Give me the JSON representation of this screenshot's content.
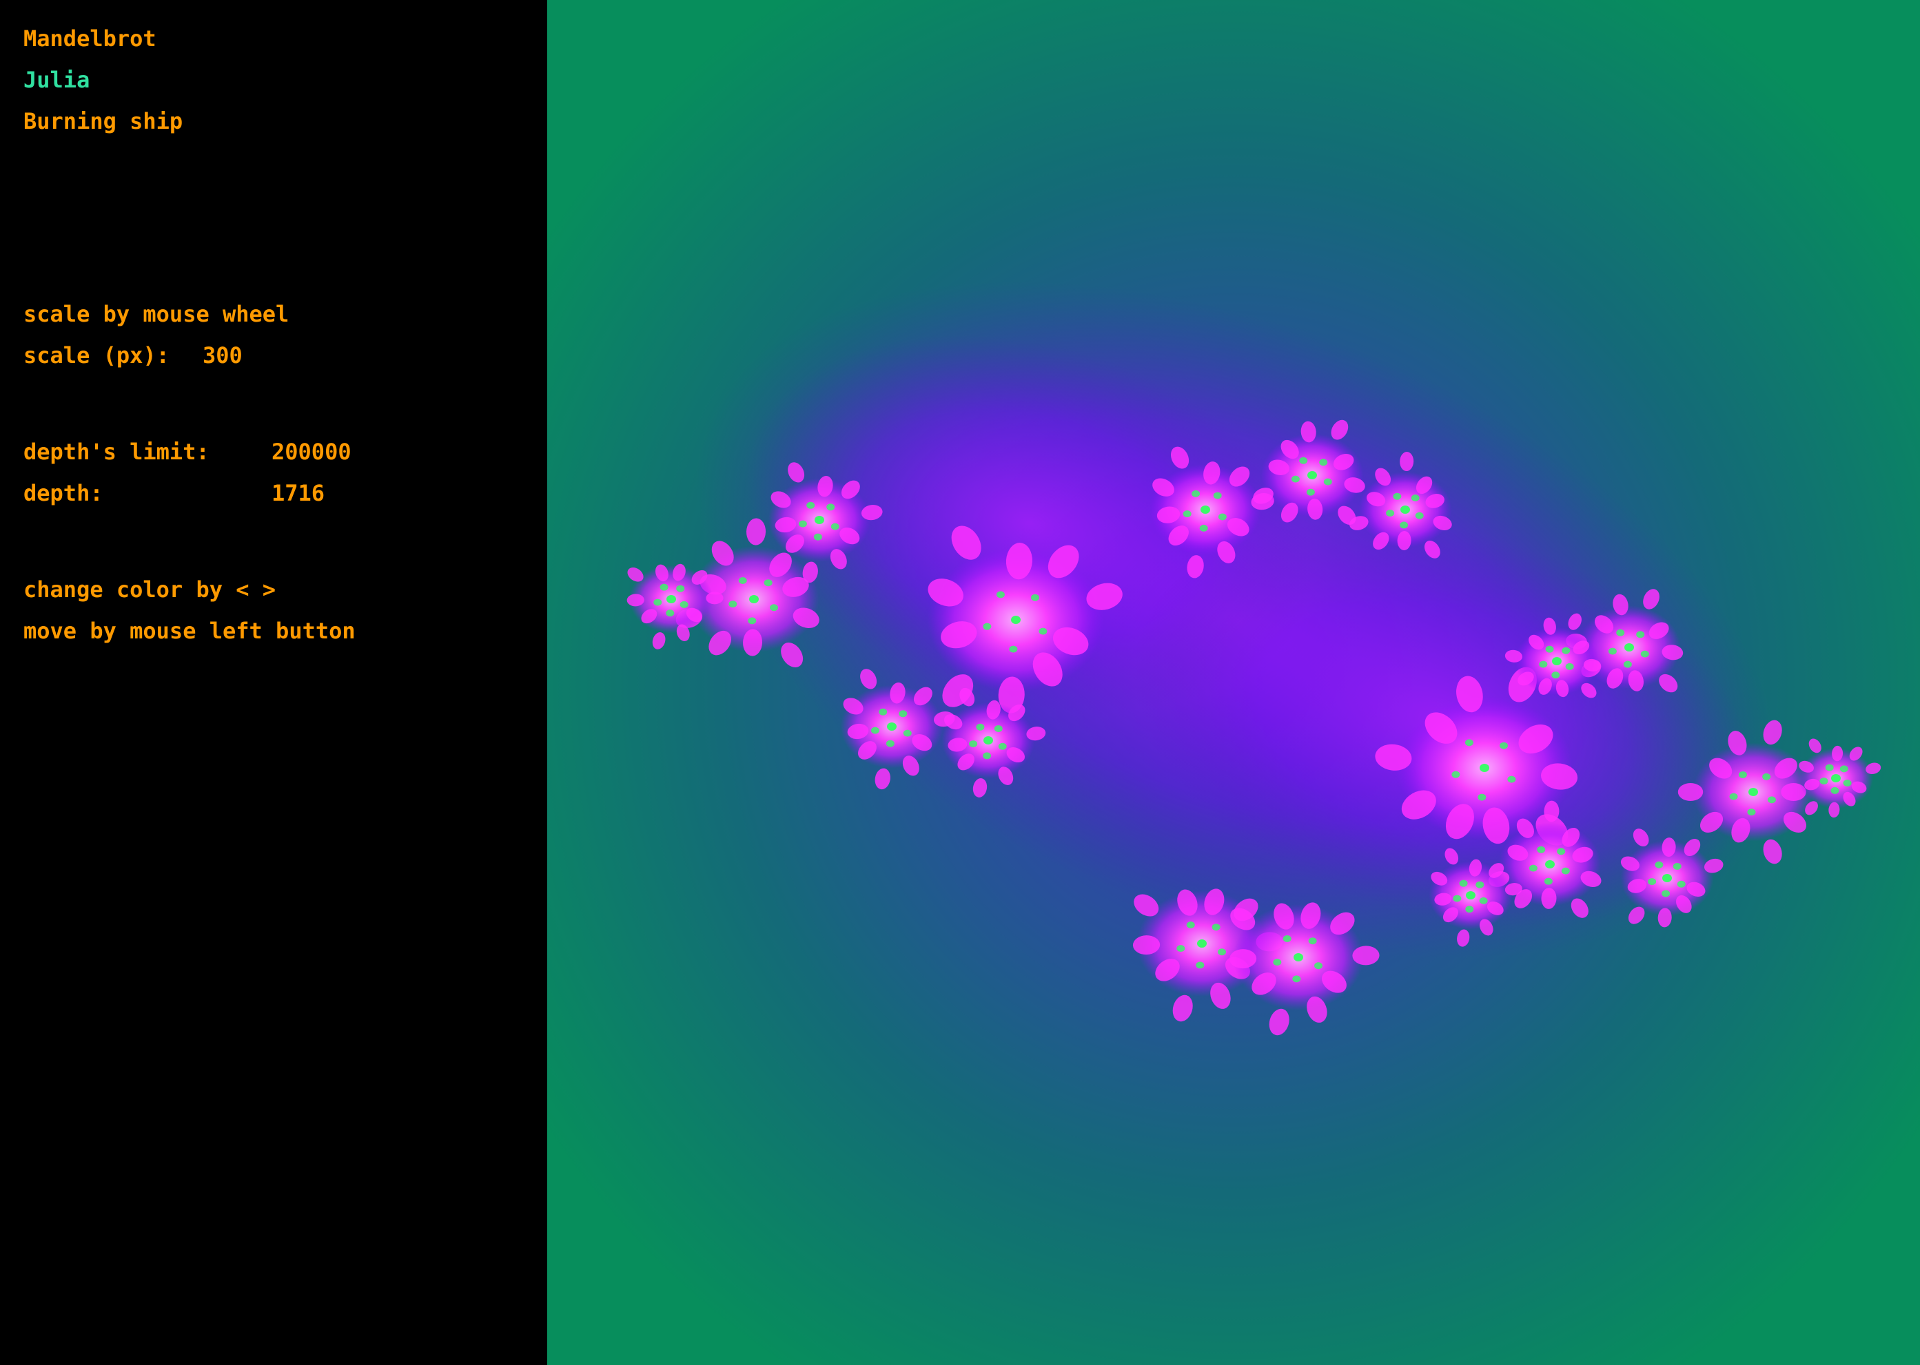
{
  "menu": {
    "items": [
      {
        "label": "Mandelbrot",
        "active": false
      },
      {
        "label": "Julia",
        "active": true
      },
      {
        "label": "Burning ship",
        "active": false
      }
    ]
  },
  "info": {
    "scale_hint": "scale by mouse wheel",
    "scale_label": "scale (px):",
    "scale_value": "300",
    "depth_limit_label": "depth's limit:",
    "depth_limit_value": "200000",
    "depth_label": "depth:",
    "depth_value": "1716",
    "color_hint": "change color by < >",
    "move_hint": "move by mouse left button"
  },
  "colors": {
    "text": "#ff9a00",
    "active": "#30e0a0",
    "panel_bg": "#000000",
    "canvas_outer": "#078e5c",
    "canvas_mid": "#1e5e90",
    "fractal_inner": "#8a10ff",
    "fractal_core": "#ff30ff",
    "fractal_spot": "#30ff60"
  }
}
